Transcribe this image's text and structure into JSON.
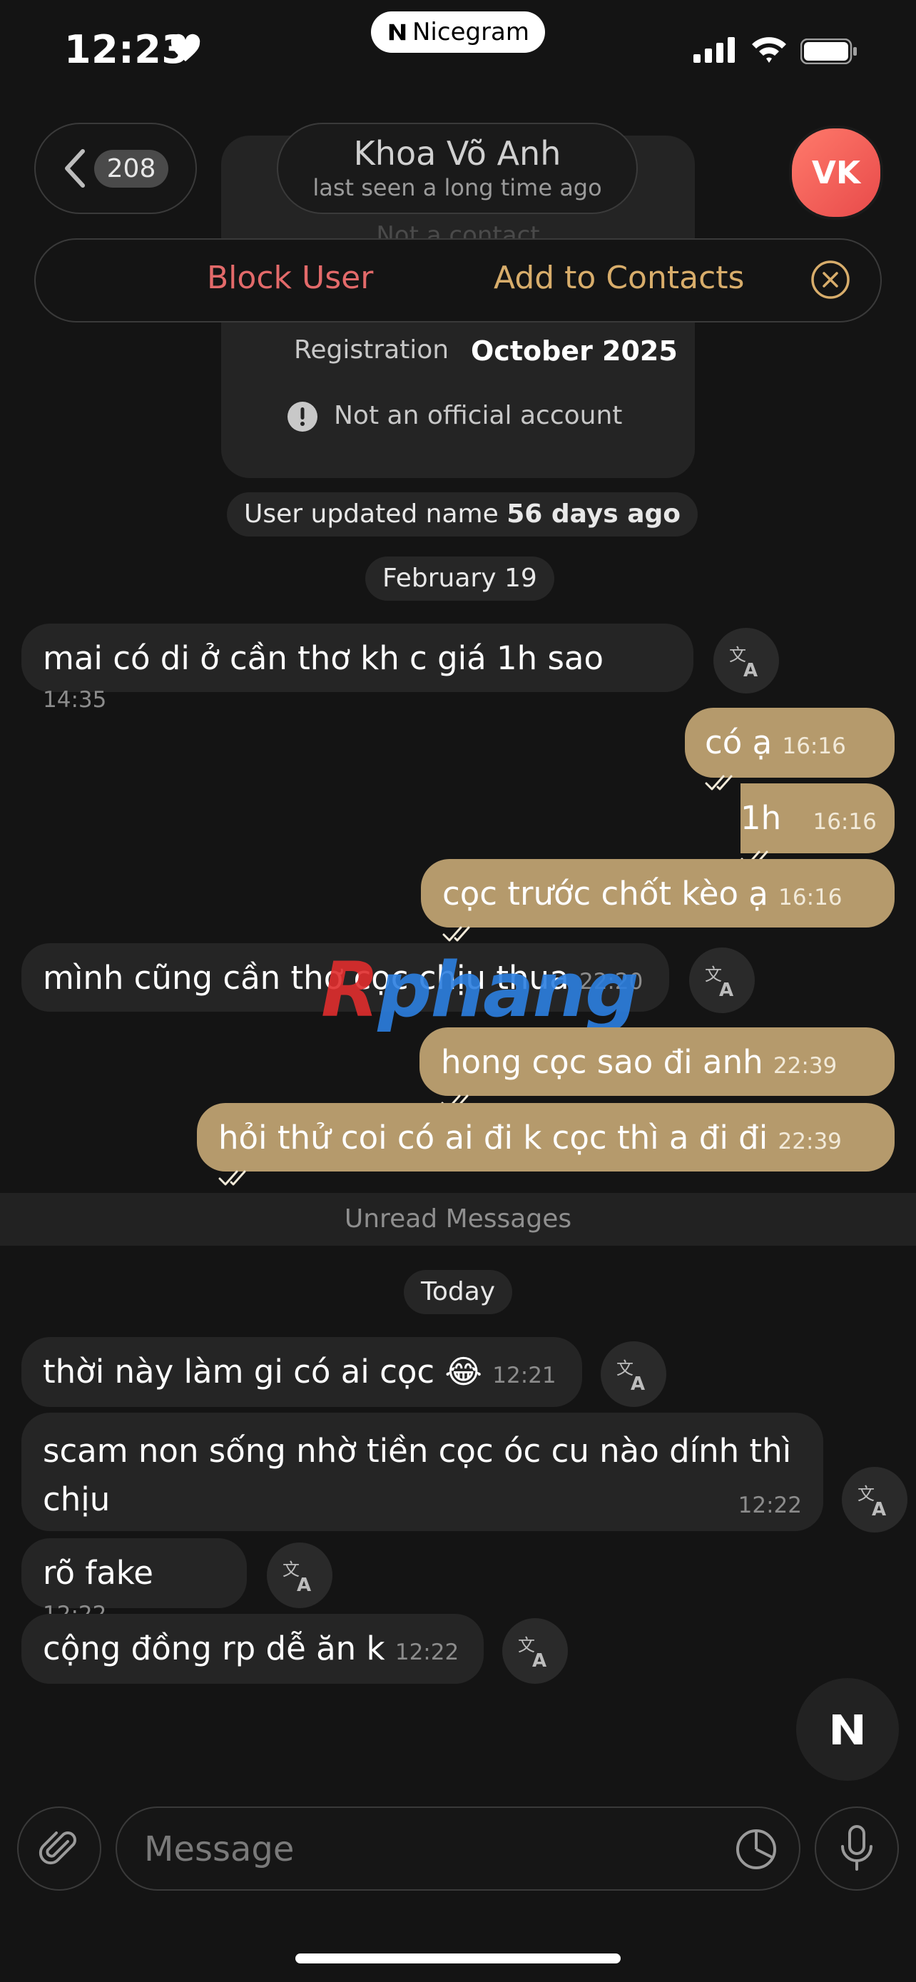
{
  "status": {
    "time": "12:23",
    "app_badge": "Nicegram"
  },
  "header": {
    "back_count": "208",
    "contact_name": "Khoa Võ Anh",
    "last_seen": "last seen a long time ago",
    "avatar_initials": "VK",
    "avatar_color": "#f0595a"
  },
  "contact_info": {
    "not_contact": "Not a contact",
    "block_label": "Block User",
    "add_label": "Add to Contacts",
    "registration_label": "Registration",
    "registration_value": "October 2025",
    "official_notice": "Not an official account"
  },
  "service": {
    "name_update_prefix": "User updated name",
    "name_update_value": "56 days ago",
    "date_1": "February 19",
    "unread": "Unread Messages",
    "date_2": "Today"
  },
  "messages": [
    {
      "dir": "in",
      "text": "mai có di ở cần thơ kh c giá 1h sao",
      "time": "14:35"
    },
    {
      "dir": "out",
      "text": "có ạ",
      "time": "16:16"
    },
    {
      "dir": "out",
      "text": "1h",
      "time": "16:16"
    },
    {
      "dir": "out",
      "text": "cọc trước chốt kèo ạ",
      "time": "16:16"
    },
    {
      "dir": "in",
      "text": "mình cũng cần thơ cọc chịu thua",
      "time": "22:20"
    },
    {
      "dir": "out",
      "text": "hong cọc sao đi anh",
      "time": "22:39"
    },
    {
      "dir": "out",
      "text": "hỏi thử coi có ai đi k cọc thì a đi đi",
      "time": "22:39"
    },
    {
      "dir": "in",
      "text": "thời này làm gi có ai cọc 😂",
      "time": "12:21"
    },
    {
      "dir": "in",
      "text": "scam non sống nhờ tiền cọc óc cu nào dính thì chịu",
      "time": "12:22"
    },
    {
      "dir": "in",
      "text": "rõ fake",
      "time": "12:22"
    },
    {
      "dir": "in",
      "text": "cộng đồng rp dễ ăn k",
      "time": "12:22"
    }
  ],
  "watermark": {
    "part_red": "R",
    "part_blue": "phang"
  },
  "composer": {
    "placeholder": "Message"
  },
  "colors": {
    "accent_gold": "#b59a6c",
    "block_red": "#e36a6a",
    "add_gold": "#d8ad6b"
  },
  "icons": [
    "heart-icon",
    "signal-icon",
    "wifi-icon",
    "battery-icon",
    "chevron-left-icon",
    "close-circle-icon",
    "warning-icon",
    "translate-icon",
    "double-check-icon",
    "nicegram-icon",
    "paperclip-icon",
    "sticker-icon",
    "microphone-icon"
  ]
}
